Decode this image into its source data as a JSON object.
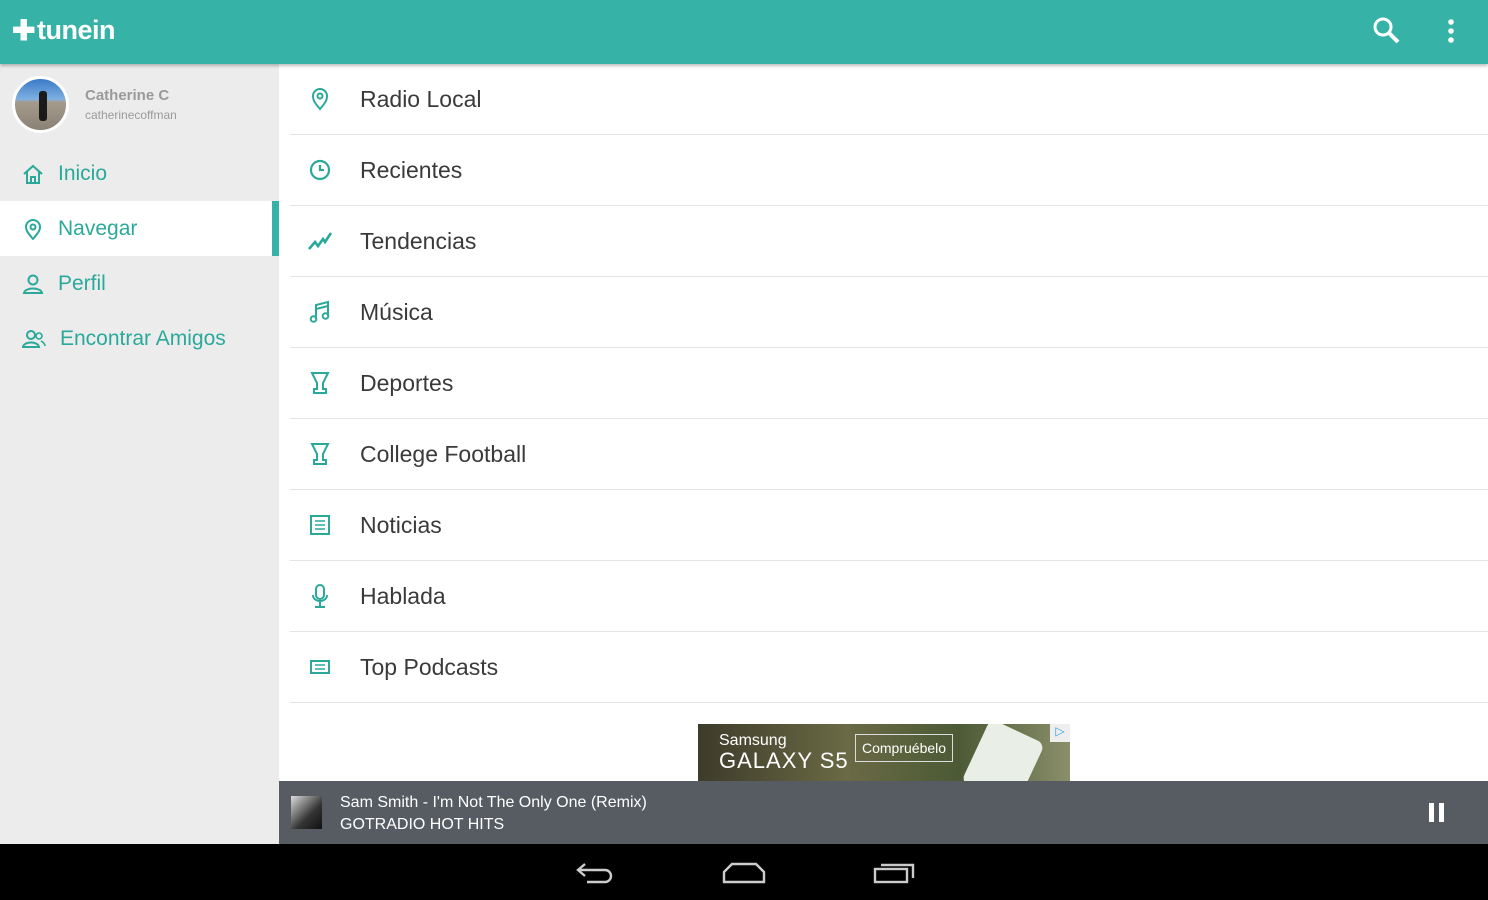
{
  "app": {
    "logo": "tunein"
  },
  "toolbar": {
    "search_icon": "search-icon",
    "menu_icon": "more-vert-icon"
  },
  "user": {
    "name": "Catherine C",
    "username": "catherinecoffman"
  },
  "sidebar": {
    "items": [
      {
        "label": "Inicio",
        "icon": "home-icon"
      },
      {
        "label": "Navegar",
        "icon": "location-pin-icon",
        "active": true
      },
      {
        "label": "Perfil",
        "icon": "person-icon"
      },
      {
        "label": "Encontrar Amigos",
        "icon": "people-icon"
      }
    ]
  },
  "categories": [
    {
      "label": "Radio Local",
      "icon": "location-pin-icon"
    },
    {
      "label": "Recientes",
      "icon": "clock-icon"
    },
    {
      "label": "Tendencias",
      "icon": "trending-icon"
    },
    {
      "label": "Música",
      "icon": "music-note-icon"
    },
    {
      "label": "Deportes",
      "icon": "trophy-icon"
    },
    {
      "label": "College Football",
      "icon": "trophy-icon"
    },
    {
      "label": "Noticias",
      "icon": "newspaper-icon"
    },
    {
      "label": "Hablada",
      "icon": "microphone-icon"
    },
    {
      "label": "Top Podcasts",
      "icon": "podcast-icon"
    }
  ],
  "ad": {
    "brand": "Samsung",
    "product": "GALAXY S5",
    "cta": "Compruébelo"
  },
  "player": {
    "title": "Sam Smith - I'm Not The Only One (Remix)",
    "station": "GOTRADIO HOT HITS",
    "state": "playing"
  },
  "colors": {
    "accent": "#36b3a6",
    "player": "#575c63",
    "sidebar": "#ececec"
  }
}
